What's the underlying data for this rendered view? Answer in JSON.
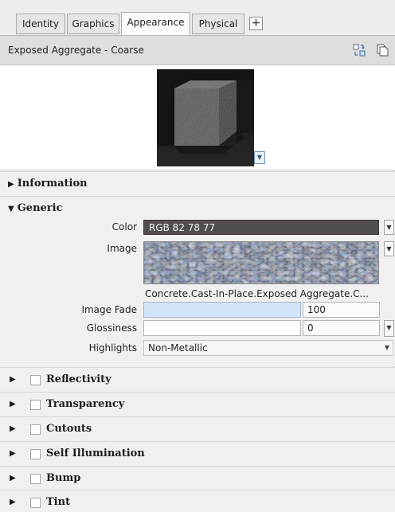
{
  "tabs": [
    {
      "label": "Identity"
    },
    {
      "label": "Graphics"
    },
    {
      "label": "Appearance"
    },
    {
      "label": "Physical"
    }
  ],
  "tab_add_label": "+",
  "material_name": "Exposed Aggregate - Coarse",
  "sections": {
    "information": "Information",
    "generic": "Generic",
    "reflectivity": "Reflectivity",
    "transparency": "Transparency",
    "cutouts": "Cutouts",
    "self_illumination": "Self Illumination",
    "bump": "Bump",
    "tint": "Tint"
  },
  "generic": {
    "color_label": "Color",
    "color_value": "RGB 82 78 77",
    "color_hex": "#524e4d",
    "image_label": "Image",
    "image_name": "Concrete.Cast-In-Place.Exposed Aggregate.C...",
    "image_fade_label": "Image Fade",
    "image_fade_value": "100",
    "image_fade_fraction": 1.0,
    "glossiness_label": "Glossiness",
    "glossiness_value": "0",
    "glossiness_fraction": 0.0,
    "highlights_label": "Highlights",
    "highlights_value": "Non-Metallic"
  },
  "icons": {
    "replace": "swap-asset-icon",
    "duplicate": "duplicate-asset-icon",
    "dropdown": "chevron-down-icon"
  },
  "colors": {
    "accent_fill": "#d2e4f7",
    "panel": "#f0f0f0"
  }
}
